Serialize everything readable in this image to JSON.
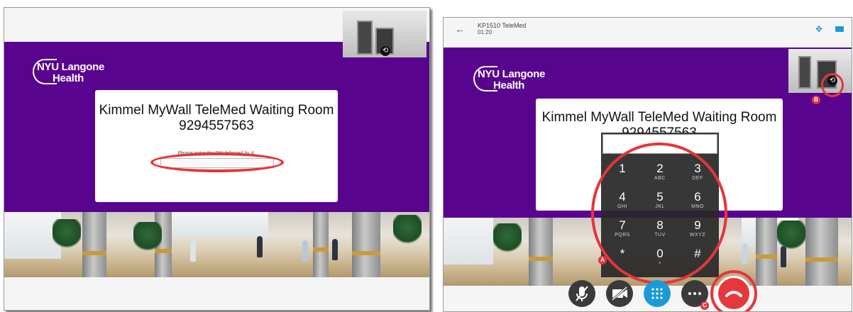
{
  "left_screen": {
    "logo": {
      "line1": "NYU Langone",
      "line2": "Health"
    },
    "card": {
      "title": "Kimmel MyWall TeleMed Waiting Room",
      "number": "9294557563",
      "prompt": "Please enter the PIN followed by #."
    }
  },
  "right_screen": {
    "header": {
      "back_icon": "back-arrow-icon",
      "call_name": "KP1510 TeleMed",
      "duration": "01:20",
      "move_icon": "move-icon",
      "camera_icon": "camera-icon"
    },
    "logo": {
      "line1": "NYU Langone",
      "line2": "Health"
    },
    "card": {
      "title": "Kimmel MyWall TeleMed Waiting Room",
      "number": "9294557563"
    },
    "keypad": {
      "keys": [
        {
          "digit": "1",
          "letters": ""
        },
        {
          "digit": "2",
          "letters": "ABC"
        },
        {
          "digit": "3",
          "letters": "DEF"
        },
        {
          "digit": "4",
          "letters": "GHI"
        },
        {
          "digit": "5",
          "letters": "JKL"
        },
        {
          "digit": "6",
          "letters": "MNO"
        },
        {
          "digit": "7",
          "letters": "PQRS"
        },
        {
          "digit": "8",
          "letters": "TUV"
        },
        {
          "digit": "9",
          "letters": "WXYZ"
        },
        {
          "digit": "*",
          "letters": ""
        },
        {
          "digit": "0",
          "letters": "+"
        },
        {
          "digit": "#",
          "letters": ""
        }
      ]
    },
    "badges": {
      "a": "A",
      "b": "B",
      "c": "C"
    },
    "controls": [
      "mute-mic-icon",
      "video-off-icon",
      "keypad-icon",
      "more-icon",
      "end-call-icon"
    ]
  },
  "colors": {
    "purple": "#59048f",
    "highlight_red": "#e4363a",
    "keypad_blue": "#1b9ad6",
    "end_call": "#e5383c"
  }
}
